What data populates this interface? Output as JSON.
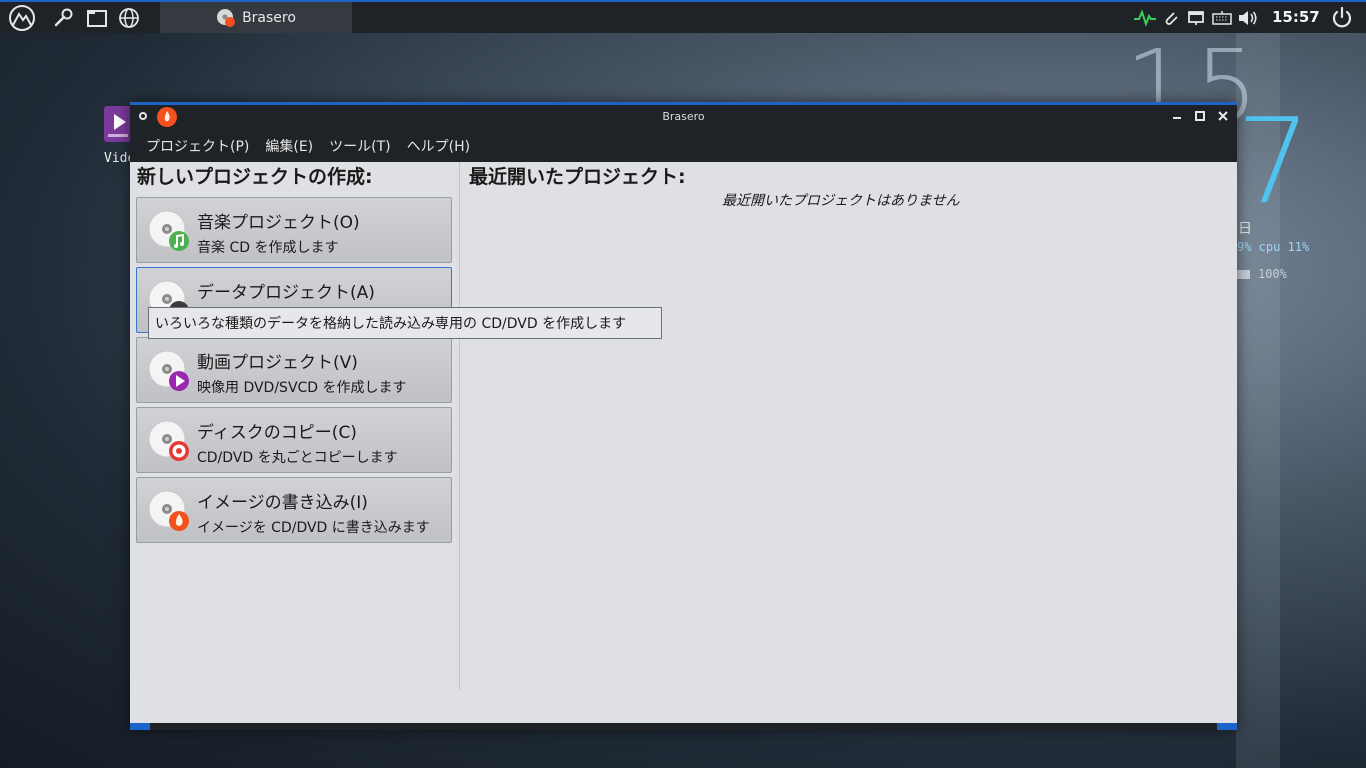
{
  "top_panel": {
    "task_label": "Brasero",
    "clock": "15:57",
    "icons": [
      "mountain-menu-icon",
      "wrench-icon",
      "window-icon",
      "globe-icon"
    ],
    "tray_icons": [
      "activity-icon",
      "paperclip-icon",
      "network-icon",
      "keyboard-icon",
      "volume-icon"
    ]
  },
  "desktop": {
    "video_icon_label": "Vide",
    "clock_hour": "15",
    "clock_minute": "7",
    "day_text": "日",
    "cpu_text": "9% cpu 11%",
    "battery_text": "100%"
  },
  "window": {
    "title": "Brasero",
    "menus": [
      "プロジェクト(P)",
      "編集(E)",
      "ツール(T)",
      "ヘルプ(H)"
    ],
    "left_heading": "新しいプロジェクトの作成:",
    "right_heading": "最近開いたプロジェクト:",
    "recent_empty": "最近開いたプロジェクトはありません",
    "projects": [
      {
        "title": "音楽プロジェクト(O)",
        "desc": "音楽 CD を作成します",
        "badge": "music-note-icon",
        "badge_color": "#4caf50"
      },
      {
        "title": "データプロジェクト(A)",
        "desc": "",
        "badge": "data-icon",
        "badge_color": "#3b3b3b"
      },
      {
        "title": "動画プロジェクト(V)",
        "desc": "映像用 DVD/SVCD を作成します",
        "badge": "play-icon",
        "badge_color": "#9c27b0"
      },
      {
        "title": "ディスクのコピー(C)",
        "desc": "CD/DVD を丸ごとコピーします",
        "badge": "target-icon",
        "badge_color": "#e53935"
      },
      {
        "title": "イメージの書き込み(I)",
        "desc": "イメージを CD/DVD に書き込みます",
        "badge": "flame-icon",
        "badge_color": "#f4511e"
      }
    ],
    "tooltip": "いろいろな種類のデータを格納した読み込み専用の CD/DVD を作成します"
  },
  "colors": {
    "accent": "#1e63c8",
    "panel": "#1f2226",
    "window_bg": "#dfe0e4",
    "clock_accent": "#4fc3ef"
  }
}
